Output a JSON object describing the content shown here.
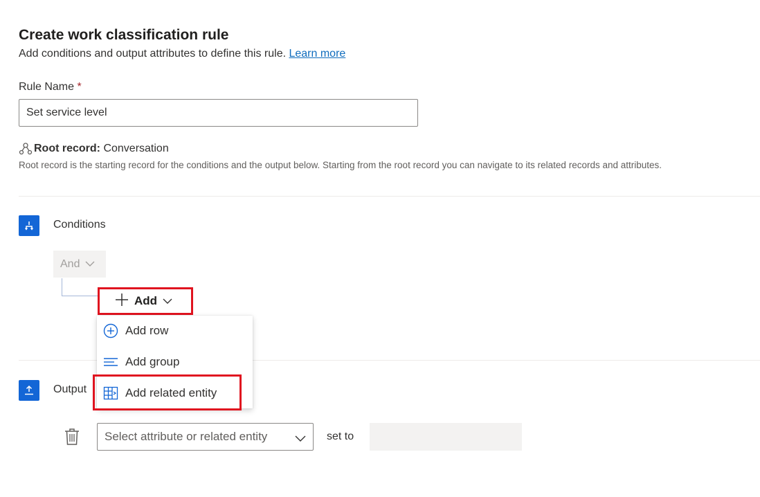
{
  "header": {
    "title": "Create work classification rule",
    "subtitle": "Add conditions and output attributes to define this rule.",
    "learn_more": "Learn more"
  },
  "rule_name": {
    "label": "Rule Name",
    "required_mark": "*",
    "value": "Set service level"
  },
  "root_record": {
    "label": "Root record:",
    "value": "Conversation",
    "description": "Root record is the starting record for the conditions and the output below. Starting from the root record you can navigate to its related records and attributes."
  },
  "conditions": {
    "title": "Conditions",
    "operator": "And",
    "add_label": "Add",
    "menu": [
      {
        "label": "Add row",
        "icon": "add-circle-icon"
      },
      {
        "label": "Add group",
        "icon": "group-lines-icon"
      },
      {
        "label": "Add related entity",
        "icon": "related-entity-icon"
      }
    ]
  },
  "output": {
    "title": "Output",
    "attribute_placeholder": "Select attribute or related entity",
    "set_to": "set to"
  },
  "colors": {
    "accent": "#1366d6",
    "highlight": "#e0131f",
    "link": "#0f6cbd"
  }
}
